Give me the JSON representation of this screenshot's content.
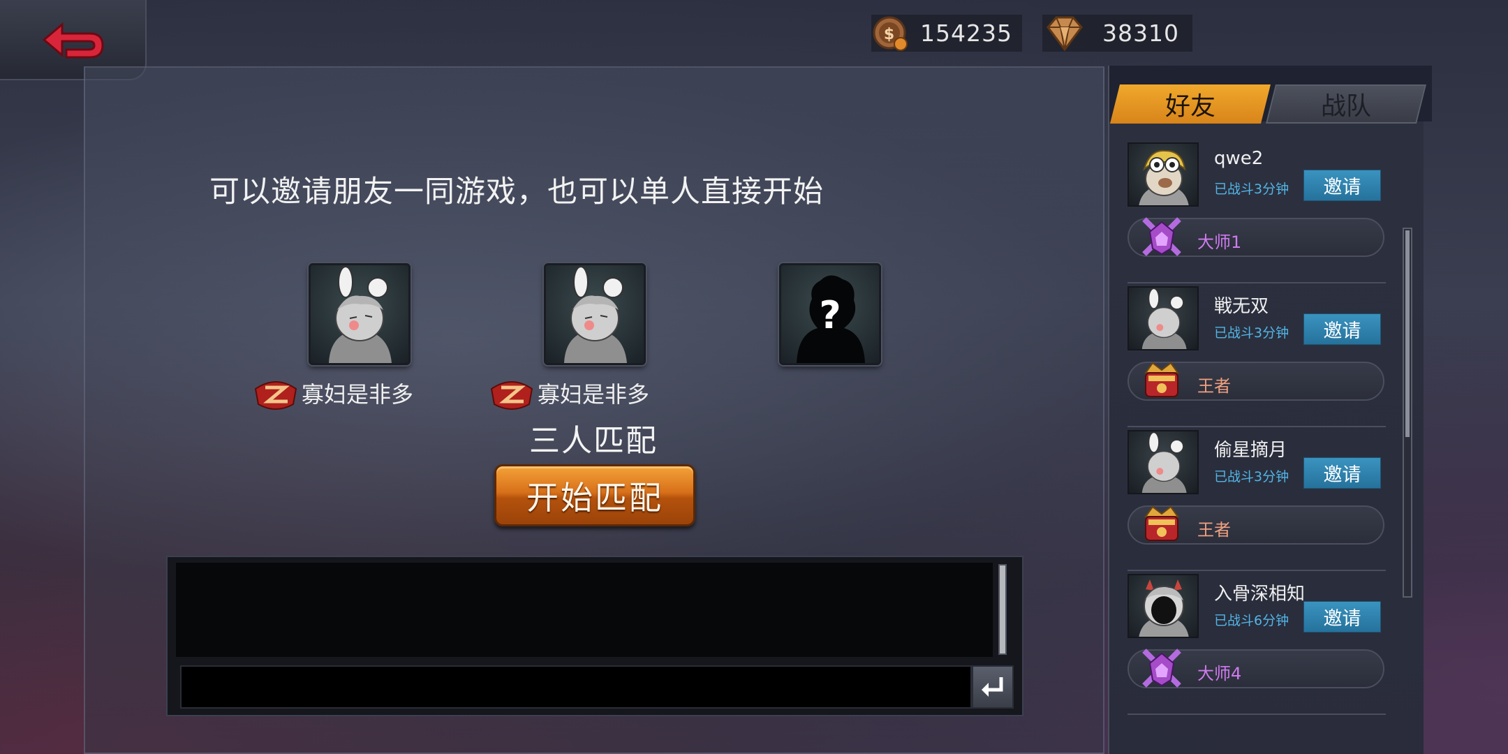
{
  "currency": {
    "coins": "154235",
    "gems": "38310"
  },
  "prompt": "可以邀请朋友一同游戏，也可以单人直接开始",
  "party": {
    "slots": [
      {
        "name": "寡妇是非多",
        "occupied": true
      },
      {
        "name": "寡妇是非多",
        "occupied": true
      },
      {
        "name": "",
        "occupied": false
      }
    ],
    "mode_label": "三人匹配",
    "start_label": "开始匹配"
  },
  "side": {
    "tabs": [
      {
        "label": "好友",
        "active": true
      },
      {
        "label": "战队",
        "active": false
      }
    ],
    "friends": [
      {
        "name": "qwe2",
        "status": "已战斗3分钟",
        "invite": "邀请",
        "rank": "大师1",
        "rank_tier": "master"
      },
      {
        "name": "戦无双",
        "status": "已战斗3分钟",
        "invite": "邀请",
        "rank": "王者",
        "rank_tier": "king"
      },
      {
        "name": "偷星摘月",
        "status": "已战斗3分钟",
        "invite": "邀请",
        "rank": "王者",
        "rank_tier": "king"
      },
      {
        "name": "入骨深相知",
        "status": "已战斗6分钟",
        "invite": "邀请",
        "rank": "大师4",
        "rank_tier": "master"
      }
    ]
  },
  "colors": {
    "accent_orange": "#d8841a",
    "invite_blue": "#2f83ad",
    "status_blue": "#52b6e8",
    "master_purple": "#d07bf0"
  }
}
